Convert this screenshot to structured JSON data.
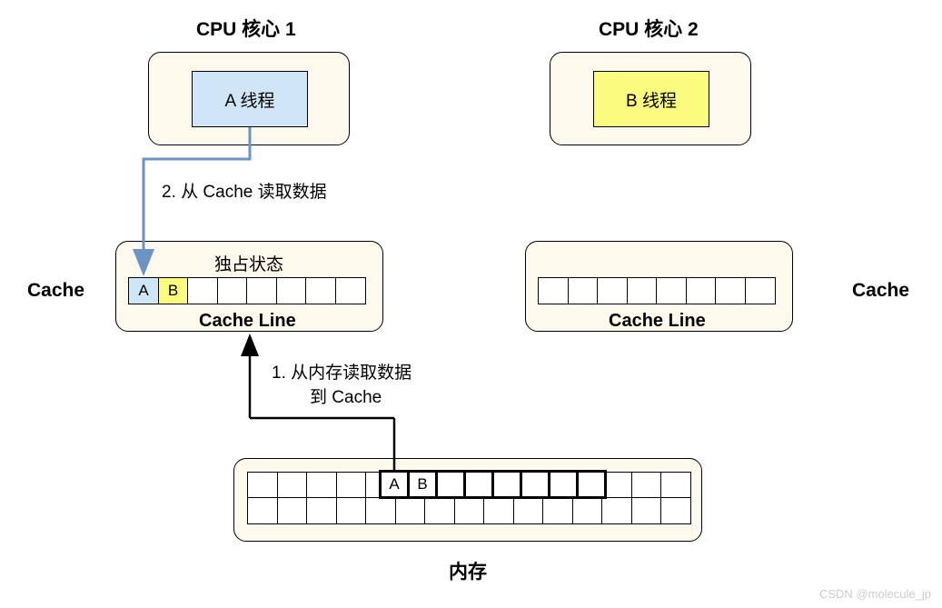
{
  "cpu1": {
    "title": "CPU 核心 1",
    "thread": "A 线程"
  },
  "cpu2": {
    "title": "CPU 核心 2",
    "thread": "B 线程"
  },
  "step2": "2. 从 Cache 读取数据",
  "step1a": "1. 从内存读取数据",
  "step1b": "到 Cache",
  "exclusiveState": "独占状态",
  "cacheLabelLeft": "Cache",
  "cacheLabelRight": "Cache",
  "cacheLineLabel1": "Cache Line",
  "cacheLineLabel2": "Cache Line",
  "memoryLabel": "内存",
  "cellA": "A",
  "cellB": "B",
  "memCellA": "A",
  "memCellB": "B",
  "watermark": "CSDN @molecule_jp"
}
